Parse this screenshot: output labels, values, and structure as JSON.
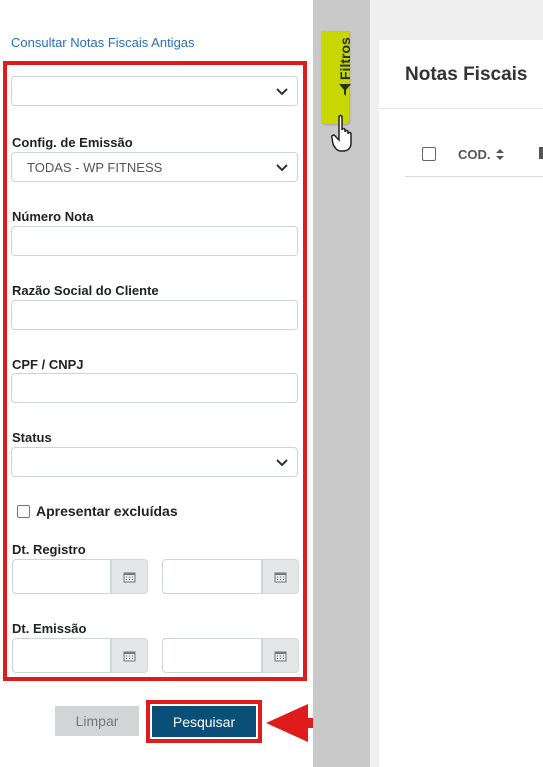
{
  "filters_panel": {
    "old_invoices_link": "Consultar Notas Fiscais Antigas",
    "first_select_value": "",
    "config_label": "Config. de Emissão",
    "config_value": "TODAS - WP FITNESS",
    "numero_label": "Número Nota",
    "numero_value": "",
    "razao_label": "Razão Social do Cliente",
    "razao_value": "",
    "cpf_label": "CPF / CNPJ",
    "cpf_value": "",
    "status_label": "Status",
    "status_value": "",
    "excluidas_label": "Apresentar excluídas",
    "dt_registro_label": "Dt. Registro",
    "dt_emissao_label": "Dt. Emissão",
    "clear_button": "Limpar",
    "search_button": "Pesquisar"
  },
  "filtros_tab": {
    "label": "Filtros"
  },
  "main": {
    "title": "Notas Fiscais",
    "columns": [
      "COD."
    ]
  },
  "colors": {
    "highlight": "#e01b1b",
    "primary_button": "#0a4f78",
    "filter_tab": "#c8d700",
    "link": "#2a6fb5"
  }
}
